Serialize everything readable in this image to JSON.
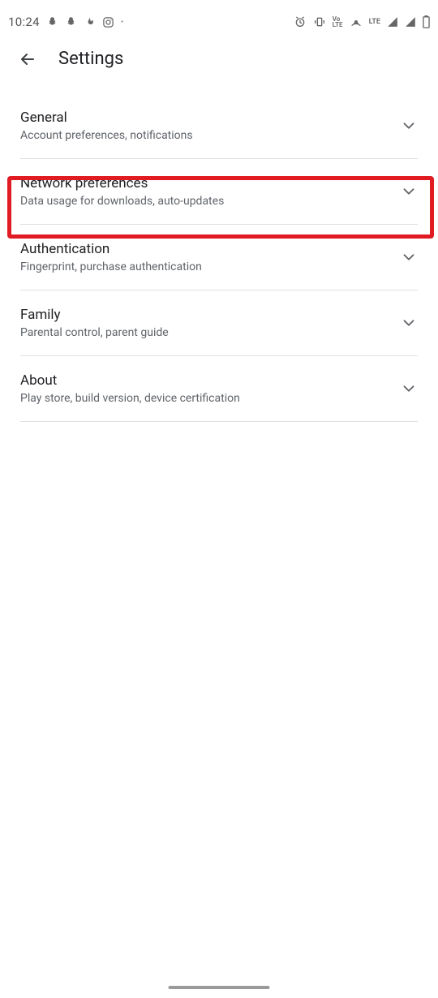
{
  "statusbar": {
    "clock": "10:24",
    "lte": "LTE"
  },
  "header": {
    "title": "Settings"
  },
  "settings": [
    {
      "title": "General",
      "subtitle": "Account preferences, notifications",
      "name": "settings-item-general"
    },
    {
      "title": "Network preferences",
      "subtitle": "Data usage for downloads, auto-updates",
      "name": "settings-item-network-preferences",
      "highlighted": true
    },
    {
      "title": "Authentication",
      "subtitle": "Fingerprint, purchase authentication",
      "name": "settings-item-authentication"
    },
    {
      "title": "Family",
      "subtitle": "Parental control, parent guide",
      "name": "settings-item-family"
    },
    {
      "title": "About",
      "subtitle": "Play store, build version, device certification",
      "name": "settings-item-about"
    }
  ]
}
